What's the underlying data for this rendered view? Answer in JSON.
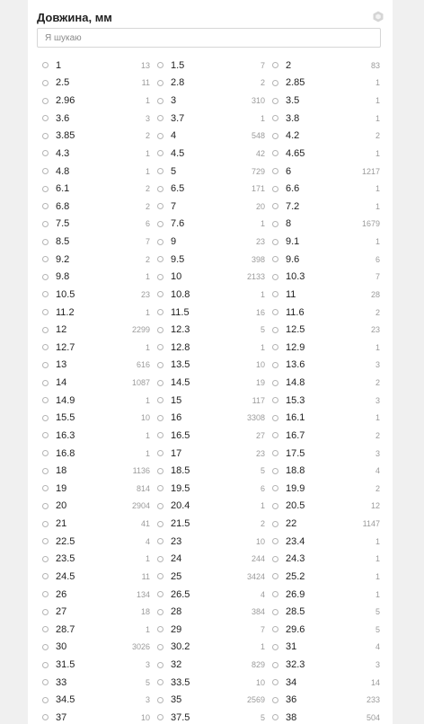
{
  "filter": {
    "title": "Довжина, мм",
    "icon": "hexagon-icon",
    "search_placeholder": "Я шукаю",
    "options": [
      {
        "value": "1",
        "count": "13"
      },
      {
        "value": "1.5",
        "count": "7"
      },
      {
        "value": "2",
        "count": "83"
      },
      {
        "value": "2.5",
        "count": "11"
      },
      {
        "value": "2.8",
        "count": "2"
      },
      {
        "value": "2.85",
        "count": "1"
      },
      {
        "value": "2.96",
        "count": "1"
      },
      {
        "value": "3",
        "count": "310"
      },
      {
        "value": "3.5",
        "count": "1"
      },
      {
        "value": "3.6",
        "count": "3"
      },
      {
        "value": "3.7",
        "count": "1"
      },
      {
        "value": "3.8",
        "count": "1"
      },
      {
        "value": "3.85",
        "count": "2"
      },
      {
        "value": "4",
        "count": "548"
      },
      {
        "value": "4.2",
        "count": "2"
      },
      {
        "value": "4.3",
        "count": "1"
      },
      {
        "value": "4.5",
        "count": "42"
      },
      {
        "value": "4.65",
        "count": "1"
      },
      {
        "value": "4.8",
        "count": "1"
      },
      {
        "value": "5",
        "count": "729"
      },
      {
        "value": "6",
        "count": "1217"
      },
      {
        "value": "6.1",
        "count": "2"
      },
      {
        "value": "6.5",
        "count": "171"
      },
      {
        "value": "6.6",
        "count": "1"
      },
      {
        "value": "6.8",
        "count": "2"
      },
      {
        "value": "7",
        "count": "20"
      },
      {
        "value": "7.2",
        "count": "1"
      },
      {
        "value": "7.5",
        "count": "6"
      },
      {
        "value": "7.6",
        "count": "1"
      },
      {
        "value": "8",
        "count": "1679"
      },
      {
        "value": "8.5",
        "count": "7"
      },
      {
        "value": "9",
        "count": "23"
      },
      {
        "value": "9.1",
        "count": "1"
      },
      {
        "value": "9.2",
        "count": "2"
      },
      {
        "value": "9.5",
        "count": "398"
      },
      {
        "value": "9.6",
        "count": "6"
      },
      {
        "value": "9.8",
        "count": "1"
      },
      {
        "value": "10",
        "count": "2133"
      },
      {
        "value": "10.3",
        "count": "7"
      },
      {
        "value": "10.5",
        "count": "23"
      },
      {
        "value": "10.8",
        "count": "1"
      },
      {
        "value": "11",
        "count": "28"
      },
      {
        "value": "11.2",
        "count": "1"
      },
      {
        "value": "11.5",
        "count": "16"
      },
      {
        "value": "11.6",
        "count": "2"
      },
      {
        "value": "12",
        "count": "2299"
      },
      {
        "value": "12.3",
        "count": "5"
      },
      {
        "value": "12.5",
        "count": "23"
      },
      {
        "value": "12.7",
        "count": "1"
      },
      {
        "value": "12.8",
        "count": "1"
      },
      {
        "value": "12.9",
        "count": "1"
      },
      {
        "value": "13",
        "count": "616"
      },
      {
        "value": "13.5",
        "count": "10"
      },
      {
        "value": "13.6",
        "count": "3"
      },
      {
        "value": "14",
        "count": "1087"
      },
      {
        "value": "14.5",
        "count": "19"
      },
      {
        "value": "14.8",
        "count": "2"
      },
      {
        "value": "14.9",
        "count": "1"
      },
      {
        "value": "15",
        "count": "117"
      },
      {
        "value": "15.3",
        "count": "3"
      },
      {
        "value": "15.5",
        "count": "10"
      },
      {
        "value": "16",
        "count": "3308"
      },
      {
        "value": "16.1",
        "count": "1"
      },
      {
        "value": "16.3",
        "count": "1"
      },
      {
        "value": "16.5",
        "count": "27"
      },
      {
        "value": "16.7",
        "count": "2"
      },
      {
        "value": "16.8",
        "count": "1"
      },
      {
        "value": "17",
        "count": "23"
      },
      {
        "value": "17.5",
        "count": "3"
      },
      {
        "value": "18",
        "count": "1136"
      },
      {
        "value": "18.5",
        "count": "5"
      },
      {
        "value": "18.8",
        "count": "4"
      },
      {
        "value": "19",
        "count": "814"
      },
      {
        "value": "19.5",
        "count": "6"
      },
      {
        "value": "19.9",
        "count": "2"
      },
      {
        "value": "20",
        "count": "2904"
      },
      {
        "value": "20.4",
        "count": "1"
      },
      {
        "value": "20.5",
        "count": "12"
      },
      {
        "value": "21",
        "count": "41"
      },
      {
        "value": "21.5",
        "count": "2"
      },
      {
        "value": "22",
        "count": "1147"
      },
      {
        "value": "22.5",
        "count": "4"
      },
      {
        "value": "23",
        "count": "10"
      },
      {
        "value": "23.4",
        "count": "1"
      },
      {
        "value": "23.5",
        "count": "1"
      },
      {
        "value": "24",
        "count": "244"
      },
      {
        "value": "24.3",
        "count": "1"
      },
      {
        "value": "24.5",
        "count": "11"
      },
      {
        "value": "25",
        "count": "3424"
      },
      {
        "value": "25.2",
        "count": "1"
      },
      {
        "value": "26",
        "count": "134"
      },
      {
        "value": "26.5",
        "count": "4"
      },
      {
        "value": "26.9",
        "count": "1"
      },
      {
        "value": "27",
        "count": "18"
      },
      {
        "value": "28",
        "count": "384"
      },
      {
        "value": "28.5",
        "count": "5"
      },
      {
        "value": "28.7",
        "count": "1"
      },
      {
        "value": "29",
        "count": "7"
      },
      {
        "value": "29.6",
        "count": "5"
      },
      {
        "value": "30",
        "count": "3026"
      },
      {
        "value": "30.2",
        "count": "1"
      },
      {
        "value": "31",
        "count": "4"
      },
      {
        "value": "31.5",
        "count": "3"
      },
      {
        "value": "32",
        "count": "829"
      },
      {
        "value": "32.3",
        "count": "3"
      },
      {
        "value": "33",
        "count": "5"
      },
      {
        "value": "33.5",
        "count": "10"
      },
      {
        "value": "34",
        "count": "14"
      },
      {
        "value": "34.5",
        "count": "3"
      },
      {
        "value": "35",
        "count": "2569"
      },
      {
        "value": "36",
        "count": "233"
      },
      {
        "value": "37",
        "count": "10"
      },
      {
        "value": "37.5",
        "count": "5"
      },
      {
        "value": "38",
        "count": "504"
      }
    ]
  }
}
